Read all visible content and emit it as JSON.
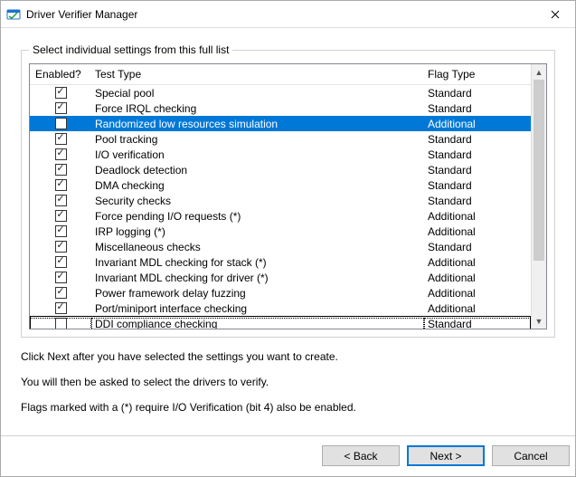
{
  "window": {
    "title": "Driver Verifier Manager"
  },
  "group": {
    "label": "Select individual settings from this full list"
  },
  "columns": {
    "enabled": "Enabled?",
    "test": "Test Type",
    "flag": "Flag Type"
  },
  "rows": [
    {
      "checked": true,
      "test": "Special pool",
      "flag": "Standard",
      "selected": false,
      "focused": false
    },
    {
      "checked": true,
      "test": "Force IRQL checking",
      "flag": "Standard",
      "selected": false,
      "focused": false
    },
    {
      "checked": false,
      "test": "Randomized low resources simulation",
      "flag": "Additional",
      "selected": true,
      "focused": false
    },
    {
      "checked": true,
      "test": "Pool tracking",
      "flag": "Standard",
      "selected": false,
      "focused": false
    },
    {
      "checked": true,
      "test": "I/O verification",
      "flag": "Standard",
      "selected": false,
      "focused": false
    },
    {
      "checked": true,
      "test": "Deadlock detection",
      "flag": "Standard",
      "selected": false,
      "focused": false
    },
    {
      "checked": true,
      "test": "DMA checking",
      "flag": "Standard",
      "selected": false,
      "focused": false
    },
    {
      "checked": true,
      "test": "Security checks",
      "flag": "Standard",
      "selected": false,
      "focused": false
    },
    {
      "checked": true,
      "test": "Force pending I/O requests (*)",
      "flag": "Additional",
      "selected": false,
      "focused": false
    },
    {
      "checked": true,
      "test": "IRP logging (*)",
      "flag": "Additional",
      "selected": false,
      "focused": false
    },
    {
      "checked": true,
      "test": "Miscellaneous checks",
      "flag": "Standard",
      "selected": false,
      "focused": false
    },
    {
      "checked": true,
      "test": "Invariant MDL checking for stack (*)",
      "flag": "Additional",
      "selected": false,
      "focused": false
    },
    {
      "checked": true,
      "test": "Invariant MDL checking for driver (*)",
      "flag": "Additional",
      "selected": false,
      "focused": false
    },
    {
      "checked": true,
      "test": "Power framework delay fuzzing",
      "flag": "Additional",
      "selected": false,
      "focused": false
    },
    {
      "checked": true,
      "test": "Port/miniport interface checking",
      "flag": "Additional",
      "selected": false,
      "focused": false
    },
    {
      "checked": false,
      "test": "DDI compliance checking",
      "flag": "Standard",
      "selected": false,
      "focused": true
    }
  ],
  "hints": {
    "line1": "Click Next after you have selected the settings you want to create.",
    "line2": "You will then be asked to select the drivers to verify.",
    "line3": "Flags marked with a (*) require I/O Verification (bit 4) also be enabled."
  },
  "buttons": {
    "back": "< Back",
    "next": "Next >",
    "cancel": "Cancel"
  }
}
